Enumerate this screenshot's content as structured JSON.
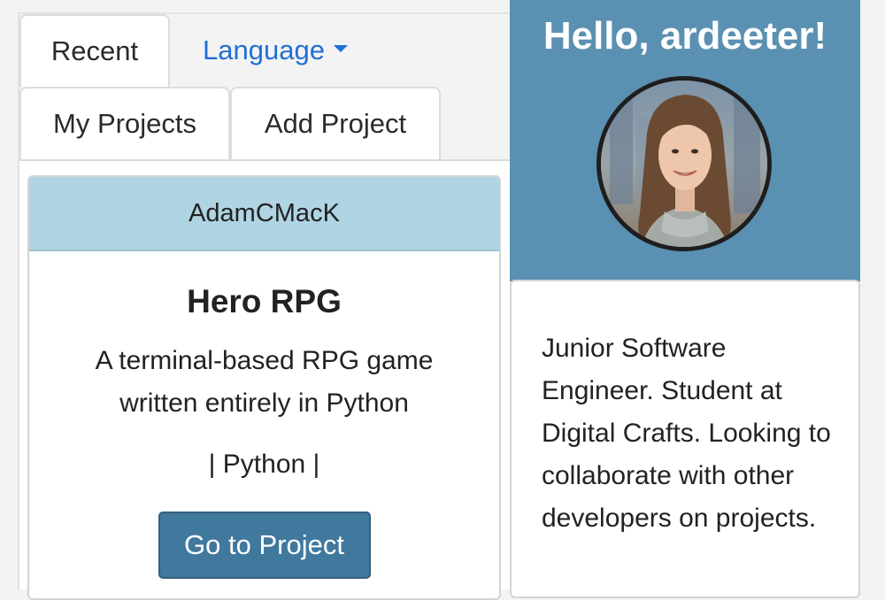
{
  "tabs": {
    "recent": "Recent",
    "language": "Language",
    "my_projects": "My Projects",
    "add_project": "Add Project"
  },
  "project_card": {
    "author": "AdamCMacK",
    "title": "Hero RPG",
    "description": "A terminal-based RPG game written entirely in Python",
    "tags": "| Python |",
    "button_label": "Go to Project"
  },
  "profile": {
    "greeting": "Hello, ardeeter!",
    "bio": "Junior Software Engineer. Student at Digital Crafts. Looking to collaborate with other developers on projects."
  },
  "colors": {
    "accent": "#5a90b1",
    "card_header": "#afd4e3",
    "button": "#41789d",
    "link": "#1f6fd6"
  }
}
